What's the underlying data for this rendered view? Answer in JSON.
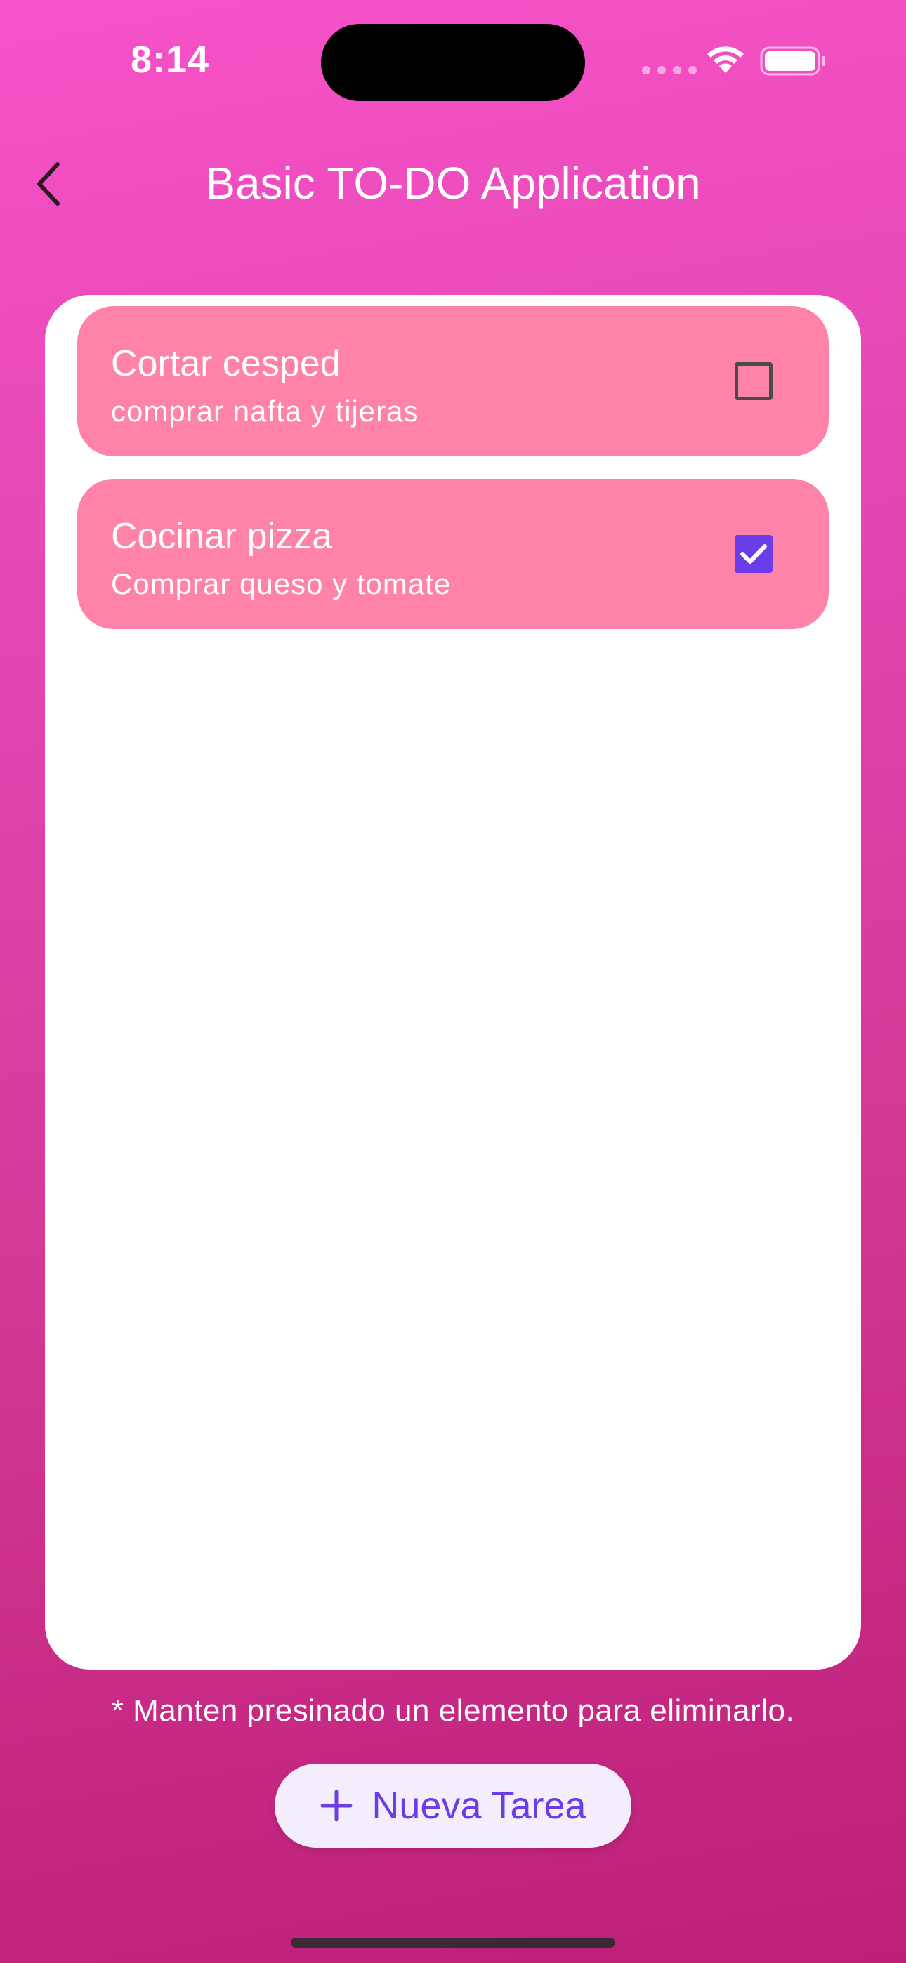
{
  "status_bar": {
    "time": "8:14"
  },
  "app_bar": {
    "title": "Basic TO-DO Application",
    "back_icon": "chevron-left-icon"
  },
  "tasks": [
    {
      "title": "Cortar cesped",
      "subtitle": "comprar nafta y tijeras",
      "checked": false
    },
    {
      "title": "Cocinar pizza",
      "subtitle": "Comprar queso y tomate",
      "checked": true
    }
  ],
  "hint": "* Manten presinado un elemento para eliminarlo.",
  "fab": {
    "label": "Nueva Tarea",
    "icon": "plus-icon"
  },
  "colors": {
    "background_top": "#f752c8",
    "background_bottom": "#bd1f78",
    "task_bg": "#ff82a8",
    "accent": "#6a3de8"
  }
}
